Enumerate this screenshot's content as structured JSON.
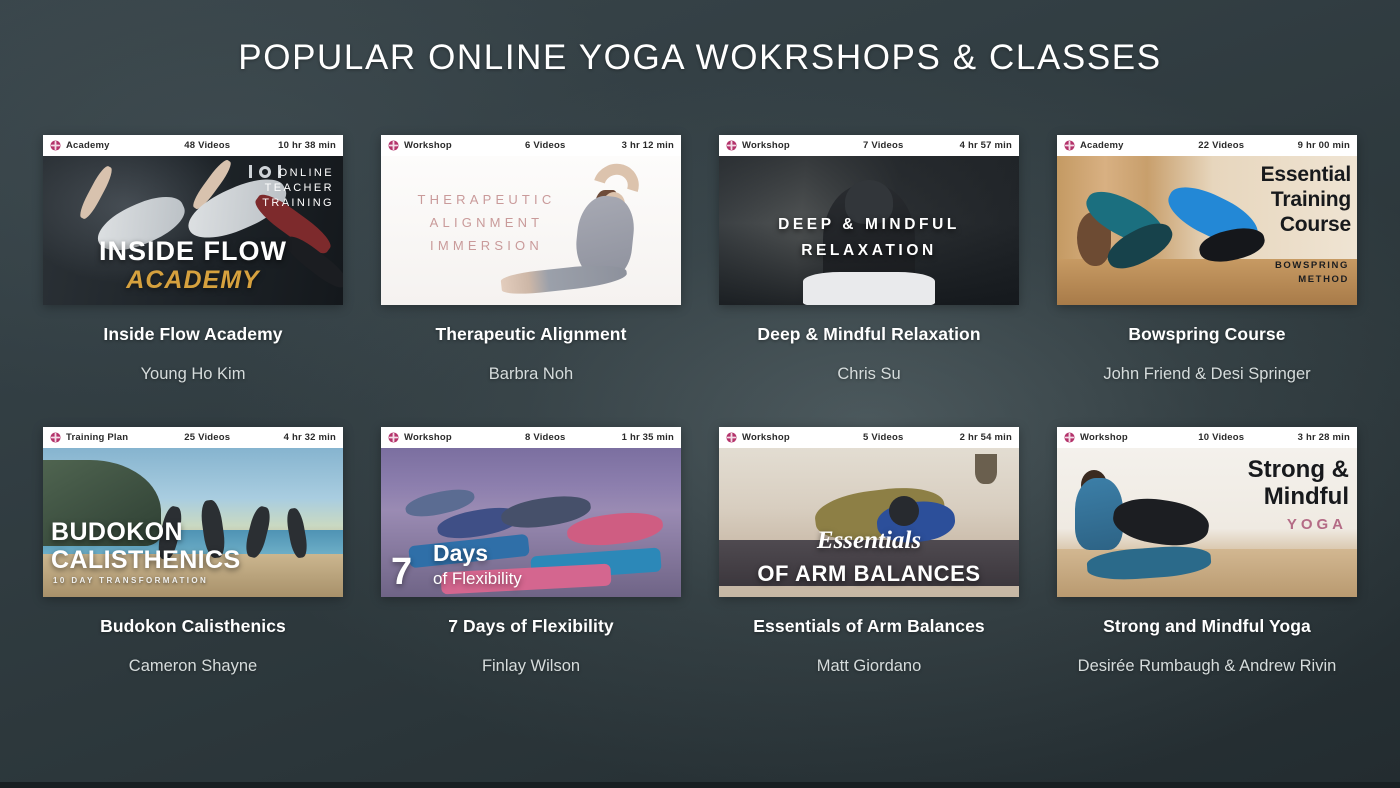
{
  "page": {
    "title": "POPULAR ONLINE YOGA WOKRSHOPS & CLASSES",
    "background_color": "#2f3a3e",
    "accent_color": "#b4336b",
    "title_color": "#ffffff",
    "author_color": "#d6dcdc"
  },
  "icons": {
    "brand_lotus": "lotus-icon"
  },
  "cards": [
    {
      "kind": "Academy",
      "videos": "48 Videos",
      "duration": "10 hr 38 min",
      "title": "Inside Flow Academy",
      "author": "Young Ho Kim",
      "thumb": {
        "line1": "INSIDE FLOW",
        "line2": "ACADEMY",
        "overlay": "ONLINE\nTEACHER\nTRAINING",
        "overlay_l1": "ONLINE",
        "overlay_l2": "TEACHER",
        "overlay_l3": "TRAINING"
      }
    },
    {
      "kind": "Workshop",
      "videos": "6 Videos",
      "duration": "3 hr 12 min",
      "title": "Therapeutic Alignment",
      "author": "Barbra Noh",
      "thumb": {
        "line1": "THERAPEUTIC",
        "line2": "ALIGNMENT",
        "line3": "IMMERSION"
      }
    },
    {
      "kind": "Workshop",
      "videos": "7 Videos",
      "duration": "4 hr 57 min",
      "title": "Deep & Mindful Relaxation",
      "author": "Chris Su",
      "thumb": {
        "line1": "DEEP & MINDFUL",
        "line2": "RELAXATION"
      }
    },
    {
      "kind": "Academy",
      "videos": "22 Videos",
      "duration": "9 hr 00 min",
      "title": "Bowspring Course",
      "author": "John Friend & Desi Springer",
      "thumb": {
        "line1": "Essential",
        "line2": "Training",
        "line3": "Course",
        "sub1": "BOWSPRING",
        "sub2": "METHOD"
      }
    },
    {
      "kind": "Training Plan",
      "videos": "25 Videos",
      "duration": "4 hr 32 min",
      "title": "Budokon Calisthenics",
      "author": "Cameron Shayne",
      "thumb": {
        "line1": "BUDOKON",
        "line2": "CALISTHENICS",
        "sub1": "10 DAY TRANSFORMATION"
      }
    },
    {
      "kind": "Workshop",
      "videos": "8 Videos",
      "duration": "1 hr 35 min",
      "title": "7 Days of Flexibility",
      "author": "Finlay Wilson",
      "thumb": {
        "numeral": "7",
        "line1": "Days",
        "line2": "of Flexibility"
      }
    },
    {
      "kind": "Workshop",
      "videos": "5 Videos",
      "duration": "2 hr 54 min",
      "title": "Essentials of Arm Balances",
      "author": "Matt Giordano",
      "thumb": {
        "line1": "Essentials",
        "line2": "OF ARM BALANCES"
      }
    },
    {
      "kind": "Workshop",
      "videos": "10 Videos",
      "duration": "3 hr 28 min",
      "title": "Strong and Mindful Yoga",
      "author": "Desirée Rumbaugh & Andrew Rivin",
      "thumb": {
        "line1": "Strong &",
        "line2": "Mindful",
        "line3": "YOGA"
      }
    }
  ]
}
